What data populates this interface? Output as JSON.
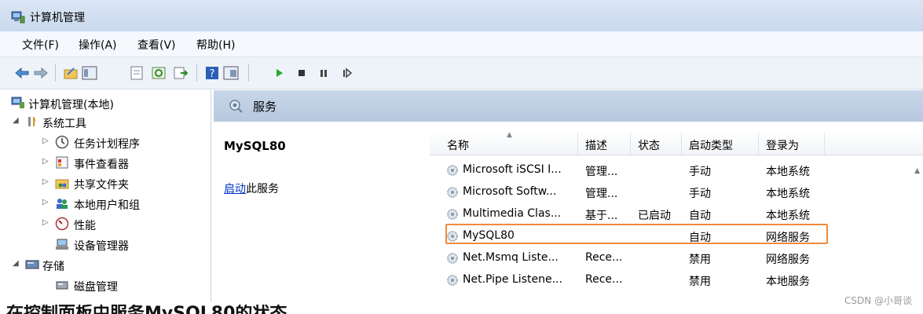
{
  "window": {
    "title": "计算机管理"
  },
  "menu": {
    "items": [
      "文件(F)",
      "操作(A)",
      "查看(V)",
      "帮助(H)"
    ]
  },
  "tree": {
    "root": "计算机管理(本地)",
    "system_tools": "系统工具",
    "children": [
      "任务计划程序",
      "事件查看器",
      "共享文件夹",
      "本地用户和组",
      "性能",
      "设备管理器"
    ],
    "storage": "存储",
    "disk": "磁盘管理"
  },
  "services": {
    "header": "服务",
    "selected_name": "MySQL80",
    "start_link": "启动",
    "start_suffix": "此服务",
    "columns": [
      "名称",
      "描述",
      "状态",
      "启动类型",
      "登录为"
    ],
    "rows": [
      {
        "name": "Microsoft iSCSI I...",
        "desc": "管理...",
        "status": "",
        "startup": "手动",
        "logon": "本地系统"
      },
      {
        "name": "Microsoft Softw...",
        "desc": "管理...",
        "status": "",
        "startup": "手动",
        "logon": "本地系统"
      },
      {
        "name": "Multimedia Clas...",
        "desc": "基于...",
        "status": "已启动",
        "startup": "自动",
        "logon": "本地系统"
      },
      {
        "name": "MySQL80",
        "desc": "",
        "status": "",
        "startup": "自动",
        "logon": "网络服务"
      },
      {
        "name": "Net.Msmq Liste...",
        "desc": "Rece...",
        "status": "",
        "startup": "禁用",
        "logon": "网络服务"
      },
      {
        "name": "Net.Pipe Listene...",
        "desc": "Rece...",
        "status": "",
        "startup": "禁用",
        "logon": "本地服务"
      }
    ]
  },
  "overlay": {
    "bottom_text": "在控制面板中服务MySQL80的状态",
    "watermark": "CSDN @小哥谈"
  },
  "colors": {
    "highlight": "#f08a3c",
    "link": "#0033cc",
    "header_bg": "#c7d6e8"
  }
}
